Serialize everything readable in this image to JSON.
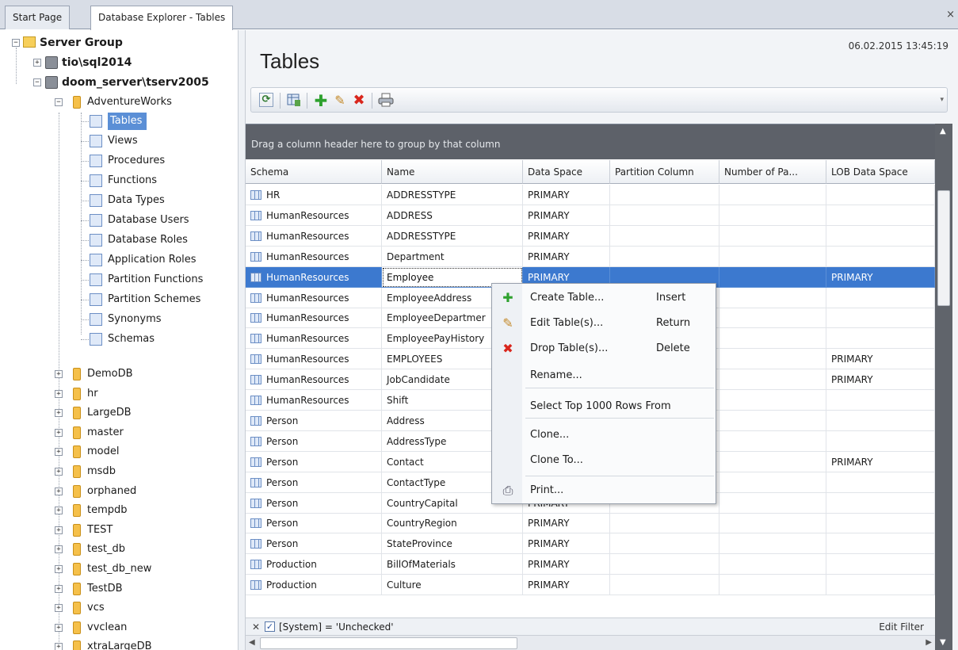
{
  "tabs": [
    {
      "label": "Start Page"
    },
    {
      "label": "Database Explorer - Tables"
    }
  ],
  "tab_close_glyph": "×",
  "tree": {
    "root": "Server Group",
    "servers": [
      {
        "label": "tio\\sql2014"
      },
      {
        "label": "doom_server\\tserv2005"
      }
    ],
    "db_expanded": "AdventureWorks",
    "objects": [
      "Tables",
      "Views",
      "Procedures",
      "Functions",
      "Data Types",
      "Database Users",
      "Database Roles",
      "Application Roles",
      "Partition Functions",
      "Partition Schemes",
      "Synonyms",
      "Schemas"
    ],
    "selected": "Tables",
    "databases": [
      "DemoDB",
      "hr",
      "LargeDB",
      "master",
      "model",
      "msdb",
      "orphaned",
      "tempdb",
      "TEST",
      "test_db",
      "test_db_new",
      "TestDB",
      "vcs",
      "vvclean",
      "xtraLargeDB"
    ]
  },
  "main": {
    "title": "Tables",
    "timestamp": "06.02.2015 13:45:19",
    "toolbar_icons": [
      "refresh-icon",
      "properties-icon",
      "add-icon",
      "edit-icon",
      "delete-icon",
      "print-icon"
    ]
  },
  "grid": {
    "group_hint": "Drag a column header here to group by that column",
    "columns": [
      "Schema",
      "Name",
      "Data Space",
      "Partition Column",
      "Number of Pa...",
      "LOB Data Space"
    ],
    "rows": [
      [
        "HR",
        "ADDRESSTYPE",
        "PRIMARY",
        "",
        "",
        ""
      ],
      [
        "HumanResources",
        "ADDRESS",
        "PRIMARY",
        "",
        "",
        ""
      ],
      [
        "HumanResources",
        "ADDRESSTYPE",
        "PRIMARY",
        "",
        "",
        ""
      ],
      [
        "HumanResources",
        "Department",
        "PRIMARY",
        "",
        "",
        ""
      ],
      [
        "HumanResources",
        "Employee",
        "PRIMARY",
        "",
        "",
        "PRIMARY"
      ],
      [
        "HumanResources",
        "EmployeeAddress",
        "",
        "",
        "",
        ""
      ],
      [
        "HumanResources",
        "EmployeeDepartmer",
        "",
        "",
        "",
        ""
      ],
      [
        "HumanResources",
        "EmployeePayHistory",
        "",
        "",
        "",
        ""
      ],
      [
        "HumanResources",
        "EMPLOYEES",
        "",
        "",
        "",
        "PRIMARY"
      ],
      [
        "HumanResources",
        "JobCandidate",
        "",
        "",
        "",
        "PRIMARY"
      ],
      [
        "HumanResources",
        "Shift",
        "",
        "",
        "",
        ""
      ],
      [
        "Person",
        "Address",
        "",
        "",
        "",
        ""
      ],
      [
        "Person",
        "AddressType",
        "",
        "",
        "",
        ""
      ],
      [
        "Person",
        "Contact",
        "",
        "",
        "",
        "PRIMARY"
      ],
      [
        "Person",
        "ContactType",
        "",
        "",
        "",
        ""
      ],
      [
        "Person",
        "CountryCapital",
        "PRIMARY",
        "",
        "",
        ""
      ],
      [
        "Person",
        "CountryRegion",
        "PRIMARY",
        "",
        "",
        ""
      ],
      [
        "Person",
        "StateProvince",
        "PRIMARY",
        "",
        "",
        ""
      ],
      [
        "Production",
        "BillOfMaterials",
        "PRIMARY",
        "",
        "",
        ""
      ],
      [
        "Production",
        "Culture",
        "PRIMARY",
        "",
        "",
        ""
      ]
    ],
    "selected_row": 4,
    "filter": {
      "text": "[System] = 'Unchecked'",
      "checked": true,
      "edit_label": "Edit Filter"
    }
  },
  "context_menu": {
    "items": [
      {
        "label": "Create Table...",
        "key": "Insert",
        "icon": "add-icon"
      },
      {
        "label": "Edit Table(s)...",
        "key": "Return",
        "icon": "edit-icon"
      },
      {
        "label": "Drop Table(s)...",
        "key": "Delete",
        "icon": "delete-icon"
      },
      {
        "label": "Rename...",
        "key": "",
        "icon": ""
      },
      {
        "label": "Select Top 1000 Rows From",
        "key": "",
        "icon": ""
      },
      {
        "label": "Clone...",
        "key": "",
        "icon": ""
      },
      {
        "label": "Clone To...",
        "key": "",
        "icon": ""
      },
      {
        "label": "Print...",
        "key": "",
        "icon": "print-icon"
      }
    ]
  },
  "colors": {
    "selection": "#3c79cf",
    "group_panel": "#5d6169",
    "add": "#2ea12e",
    "delete": "#d9261c"
  }
}
